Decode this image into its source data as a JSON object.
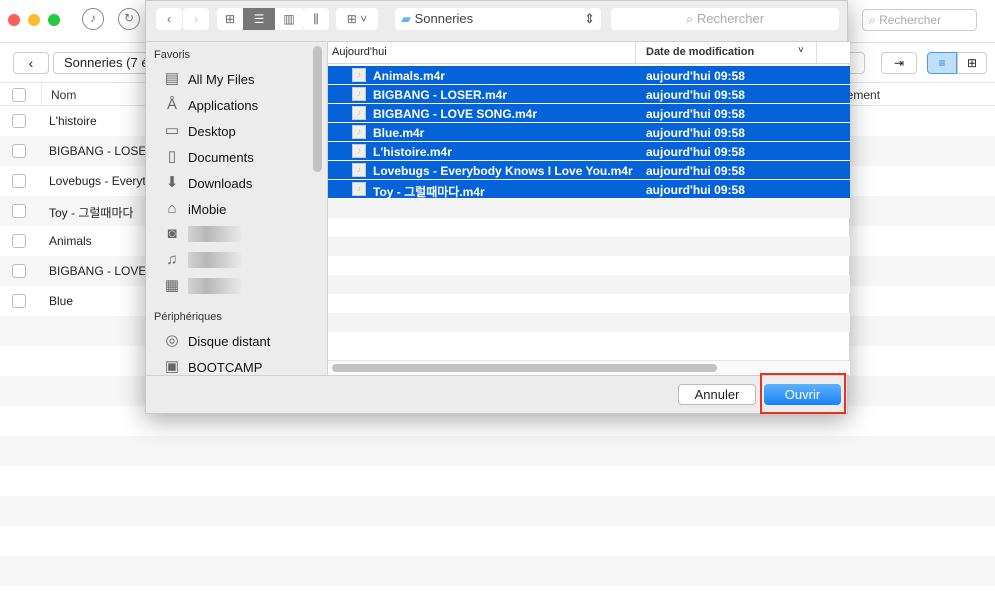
{
  "app": {
    "breadcrumb": "Sonneries (7 é",
    "search_placeholder": "Rechercher",
    "columns": {
      "name": "Nom",
      "right": "nement"
    },
    "rows": [
      "L'histoire",
      "BIGBANG - LOSE",
      "Lovebugs - Everyt",
      "Toy - 그럴때마다",
      "Animals",
      "BIGBANG - LOVE",
      "Blue"
    ]
  },
  "dialog": {
    "location": "Sonneries",
    "search_placeholder": "Rechercher",
    "sidebar": {
      "favorites_header": "Favoris",
      "favorites": [
        {
          "label": "All My Files",
          "icon": "all-files-icon"
        },
        {
          "label": "Applications",
          "icon": "applications-icon"
        },
        {
          "label": "Desktop",
          "icon": "desktop-icon"
        },
        {
          "label": "Documents",
          "icon": "documents-icon"
        },
        {
          "label": "Downloads",
          "icon": "downloads-icon"
        },
        {
          "label": "iMobie",
          "icon": "home-icon"
        }
      ],
      "devices_header": "Périphériques",
      "devices": [
        {
          "label": "Disque distant",
          "icon": "disc-icon"
        },
        {
          "label": "BOOTCAMP",
          "icon": "drive-icon"
        }
      ]
    },
    "columns": {
      "name": "Aujourd'hui",
      "date": "Date de modification"
    },
    "files": [
      {
        "name": "Animals.m4r",
        "date": "aujourd'hui 09:58"
      },
      {
        "name": "BIGBANG - LOSER.m4r",
        "date": "aujourd'hui 09:58"
      },
      {
        "name": "BIGBANG - LOVE SONG.m4r",
        "date": "aujourd'hui 09:58"
      },
      {
        "name": "Blue.m4r",
        "date": "aujourd'hui 09:58"
      },
      {
        "name": "L'histoire.m4r",
        "date": "aujourd'hui 09:58"
      },
      {
        "name": "Lovebugs - Everybody Knows I Love You.m4r",
        "date": "aujourd'hui 09:58"
      },
      {
        "name": "Toy - 그럴때마다.m4r",
        "date": "aujourd'hui 09:58"
      }
    ],
    "cancel": "Annuler",
    "open": "Ouvrir",
    "selection_color": "#0463d8",
    "highlight_color": "#e8321e"
  }
}
